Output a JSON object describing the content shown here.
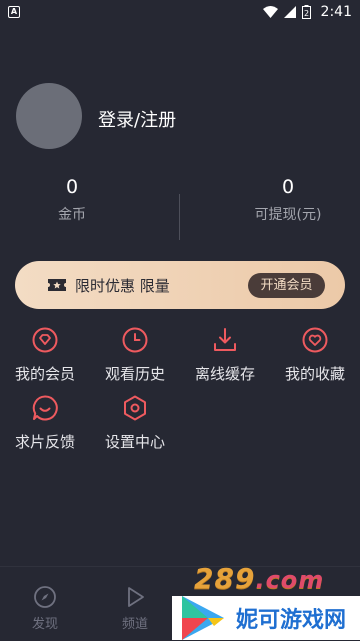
{
  "status_bar": {
    "time": "2:41",
    "app_icon_letter": "A",
    "battery": "2"
  },
  "profile": {
    "login_label": "登录/注册"
  },
  "stats": {
    "coins": {
      "value": "0",
      "label": "金币"
    },
    "withdraw": {
      "value": "0",
      "label": "可提现(元)"
    }
  },
  "vip_banner": {
    "text": "限时优惠 限量",
    "button_label": "开通会员"
  },
  "menu": [
    {
      "label": "我的会员",
      "icon": "diamond-icon"
    },
    {
      "label": "观看历史",
      "icon": "clock-icon"
    },
    {
      "label": "离线缓存",
      "icon": "download-icon"
    },
    {
      "label": "我的收藏",
      "icon": "heart-icon"
    },
    {
      "label": "求片反馈",
      "icon": "chat-icon"
    },
    {
      "label": "设置中心",
      "icon": "settings-icon"
    }
  ],
  "tabbar": [
    {
      "label": "发现",
      "icon": "compass-icon"
    },
    {
      "label": "频道",
      "icon": "play-icon"
    }
  ],
  "watermark": {
    "site": "289",
    "domain": ".com",
    "name": "妮可游戏网"
  },
  "colors": {
    "accent": "#ee5a5f",
    "background": "#262833",
    "vip_gold": "#f3dcc4",
    "vip_button": "#4a3c39"
  }
}
